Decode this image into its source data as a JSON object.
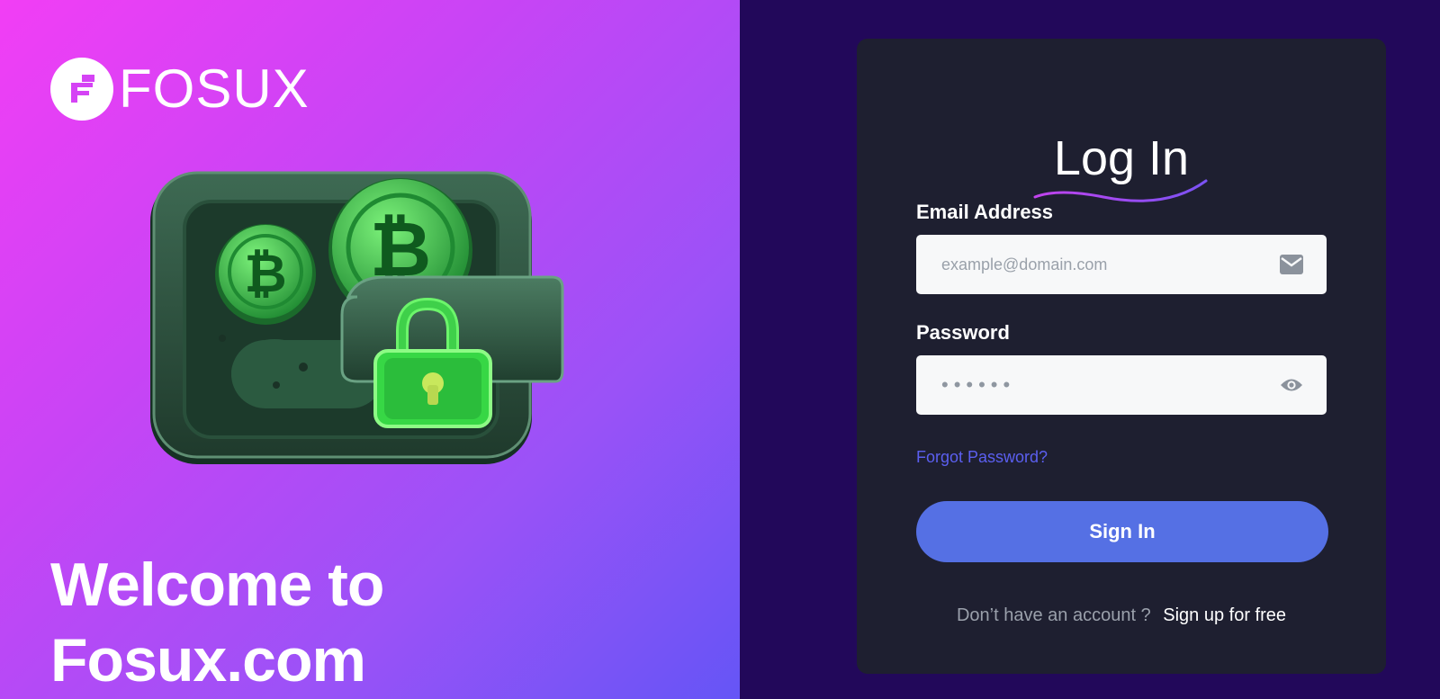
{
  "brand": {
    "name": "FOSUX",
    "logo_icon": "fosux-logo-icon"
  },
  "hero": {
    "welcome_line1": "Welcome to",
    "welcome_line2": "Fosux.com",
    "illustration": "crypto-wallet-lock-illustration",
    "coin_symbol": "₿"
  },
  "login": {
    "title": "Log In",
    "email_label": "Email Address",
    "email_placeholder": "example@domain.com",
    "email_icon": "mail-icon",
    "password_label": "Password",
    "password_value": "••••••",
    "password_icon": "eye-icon",
    "forgot_label": "Forgot Password?",
    "signin_label": "Sign In",
    "no_account_text": "Don’t have an account ?",
    "signup_label": "Sign up for free"
  },
  "colors": {
    "gradient_start": "#f23ef5",
    "gradient_end": "#6555f6",
    "page_bg": "#22085a",
    "card_bg": "#1e1f30",
    "accent": "#5570e4",
    "link": "#5b5ff0",
    "wallet_green": "#3ce65a"
  }
}
